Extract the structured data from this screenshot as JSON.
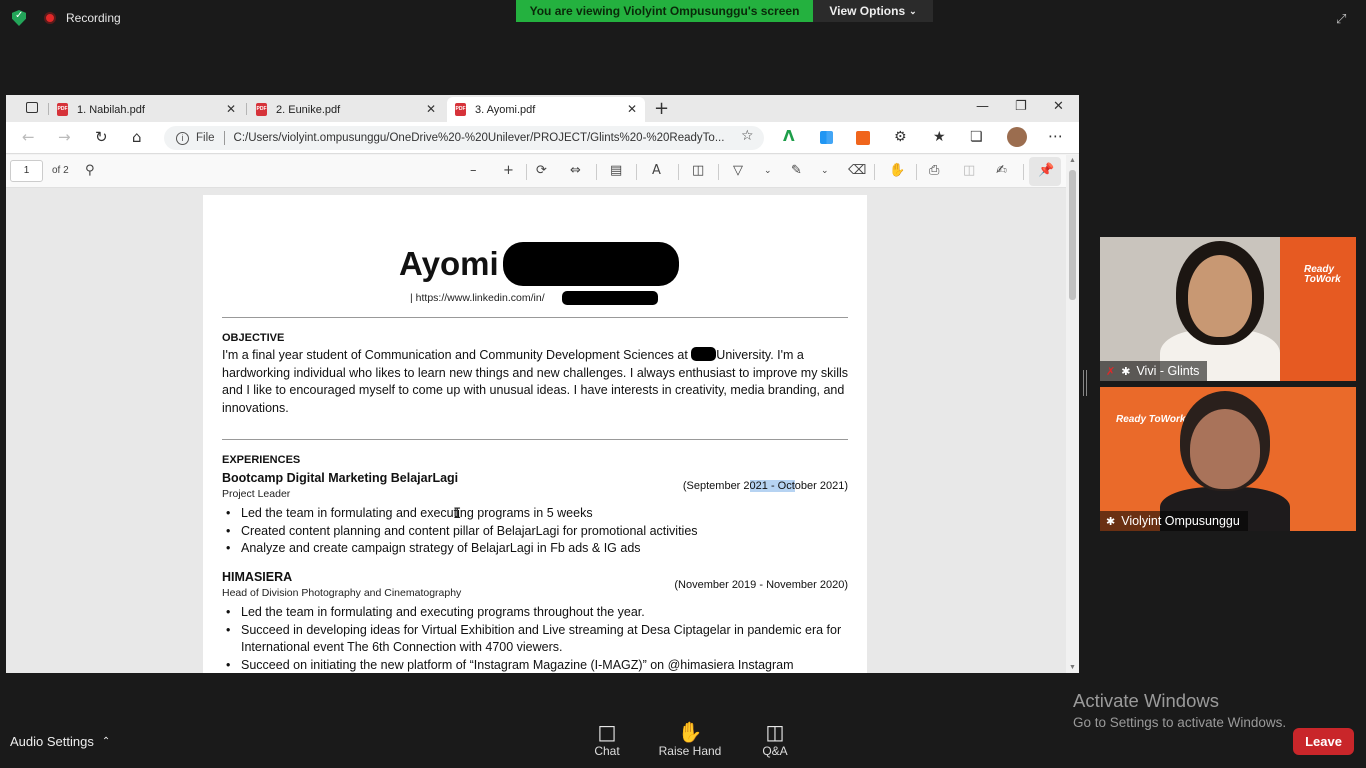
{
  "zoom": {
    "recording_label": "Recording",
    "banner_text": "You are viewing Violyint Ompusunggu's screen",
    "view_options_label": "View Options",
    "audio_settings_label": "Audio Settings",
    "controls": {
      "chat": "Chat",
      "raise_hand": "Raise Hand",
      "qa": "Q&A"
    },
    "leave_label": "Leave",
    "participants": [
      {
        "name": "Vivi - Glints",
        "muted": true,
        "pinned": true,
        "logo": "Ready ToWork"
      },
      {
        "name": "Violyint Ompusunggu",
        "muted": false,
        "pinned": true,
        "logo": "Ready ToWork"
      }
    ]
  },
  "browser": {
    "tabs": [
      {
        "label": "1. Nabilah.pdf",
        "active": false
      },
      {
        "label": "2. Eunike.pdf",
        "active": false
      },
      {
        "label": "3. Ayomi.pdf",
        "active": true
      }
    ],
    "address": {
      "scheme_label": "File",
      "url": "C:/Users/violyint.ompusunggu/OneDrive%20-%20Unilever/PROJECT/Glints%20-%20ReadyTo..."
    },
    "pdf_toolbar": {
      "page_current": "1",
      "page_total": "of 2"
    }
  },
  "resume": {
    "name": "Ayomi",
    "linkedin": "| https://www.linkedin.com/in/",
    "linkedin_tail": ")",
    "objective_heading": "OBJECTIVE",
    "objective_part1": "I'm a final year student of Communication and Community Development Sciences at",
    "objective_part2": "University. I'm a hardworking individual who likes to learn new things and new challenges. I always enthusiast to improve my skills and I like to encouraged myself to come up with unusual ideas. I have interests in creativity, media branding, and innovations.",
    "experiences_heading": "EXPERIENCES",
    "jobs": [
      {
        "title": "Bootcamp Digital Marketing BelajarLagi",
        "role": "Project Leader",
        "date_pre": "(September 2",
        "date_hl": "021 - Oct",
        "date_post": "ober 2021)",
        "bullets": [
          "Led the team in formulating and executing programs in 5 weeks",
          "Created content planning and content pillar of BelajarLagi for promotional activities",
          "Analyze and create campaign strategy of BelajarLagi in Fb ads & IG ads"
        ]
      },
      {
        "title": "HIMASIERA",
        "role": "Head of Division Photography and Cinematography",
        "date": "(November 2019 - November 2020)",
        "bullets": [
          "Led the team in formulating and executing programs throughout the year.",
          "Succeed in developing ideas for Virtual Exhibition and Live streaming at Desa Ciptagelar in pandemic era for International event The 6th Connection with 4700 viewers.",
          "Succeed on initiating the new platform of “Instagram Magazine (I-MAGZ)” on @himasiera Instagram"
        ]
      }
    ]
  },
  "os": {
    "activate_title": "Activate Windows",
    "activate_sub": "Go to Settings to activate Windows."
  }
}
